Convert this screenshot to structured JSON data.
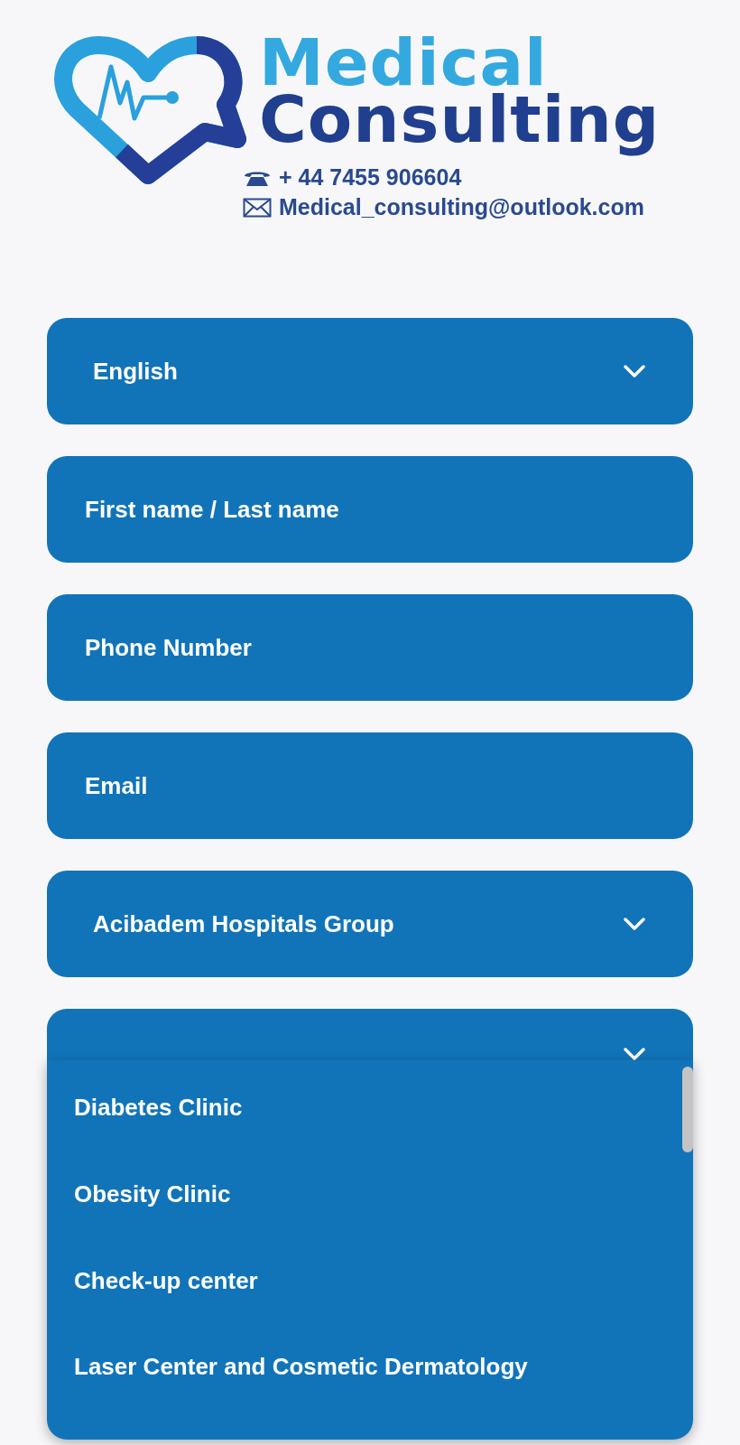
{
  "logo": {
    "title_line_1": "Medical",
    "title_line_2": "Consulting",
    "phone": "+ 44 7455 906604",
    "email": "Medical_consulting@outlook.com"
  },
  "form": {
    "fields": [
      {
        "kind": "select",
        "value": "English",
        "expanded": false
      },
      {
        "kind": "input",
        "placeholder": "First name / Last name"
      },
      {
        "kind": "input",
        "placeholder": "Phone Number"
      },
      {
        "kind": "input",
        "placeholder": "Email"
      },
      {
        "kind": "select",
        "value": "Acibadem Hospitals Group",
        "expanded": false
      },
      {
        "kind": "select",
        "expanded": true,
        "options": [
          "Diabetes Clinic",
          "Obesity Clinic",
          "Check-up center",
          "Laser Center and Cosmetic Dermatology"
        ]
      }
    ]
  }
}
